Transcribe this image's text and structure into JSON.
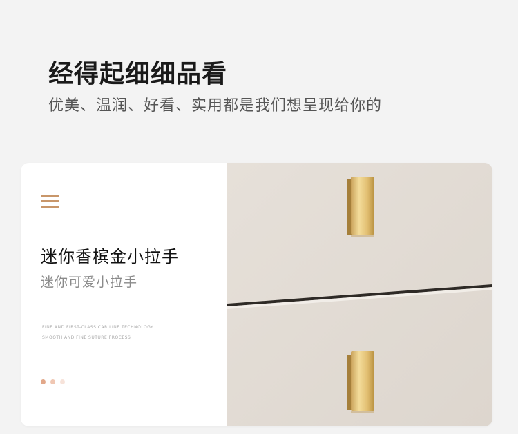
{
  "header": {
    "title": "经得起细细品看",
    "subtitle": "优美、温润、好看、实用都是我们想呈现给你的"
  },
  "card": {
    "title": "迷你香槟金小拉手",
    "subtitle": "迷你可爱小拉手",
    "english_line_1": "FINE AND FIRST-CLASS CAR LINE TECHNOLOGY",
    "english_line_2": "SMOOTH AND FINE SUTURE PROCESS",
    "menu_icon": "menu-icon",
    "accent_color": "#c8966a",
    "pagination": {
      "total": 3,
      "active": 1
    }
  }
}
